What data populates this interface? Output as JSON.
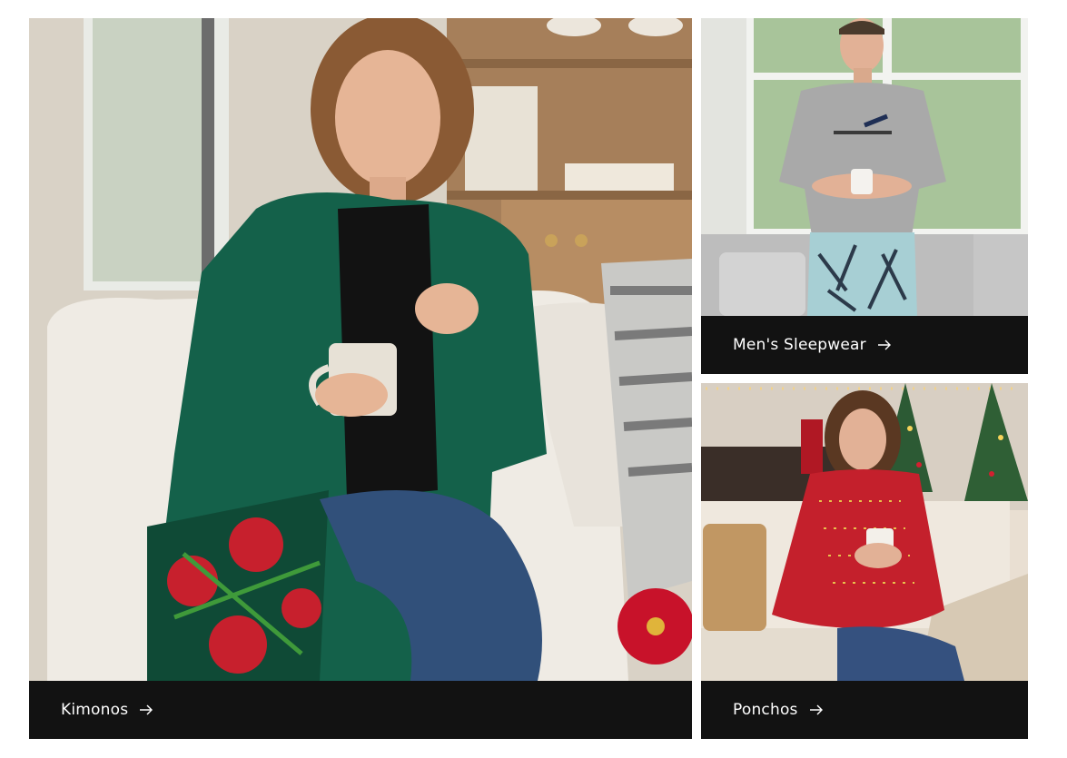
{
  "collections": [
    {
      "label": "Kimonos",
      "icon": "arrow-right-icon",
      "photo": "woman-green-kimono-holding-mug-photo"
    },
    {
      "label": "Men's Sleepwear",
      "icon": "arrow-right-icon",
      "photo": "man-gray-tshirt-pajama-pants-photo"
    },
    {
      "label": "Ponchos",
      "icon": "arrow-right-icon",
      "photo": "woman-red-poncho-christmas-photo"
    }
  ],
  "colors": {
    "caption_bg": "#121212",
    "caption_text": "#ffffff",
    "page_bg": "#ffffff"
  }
}
